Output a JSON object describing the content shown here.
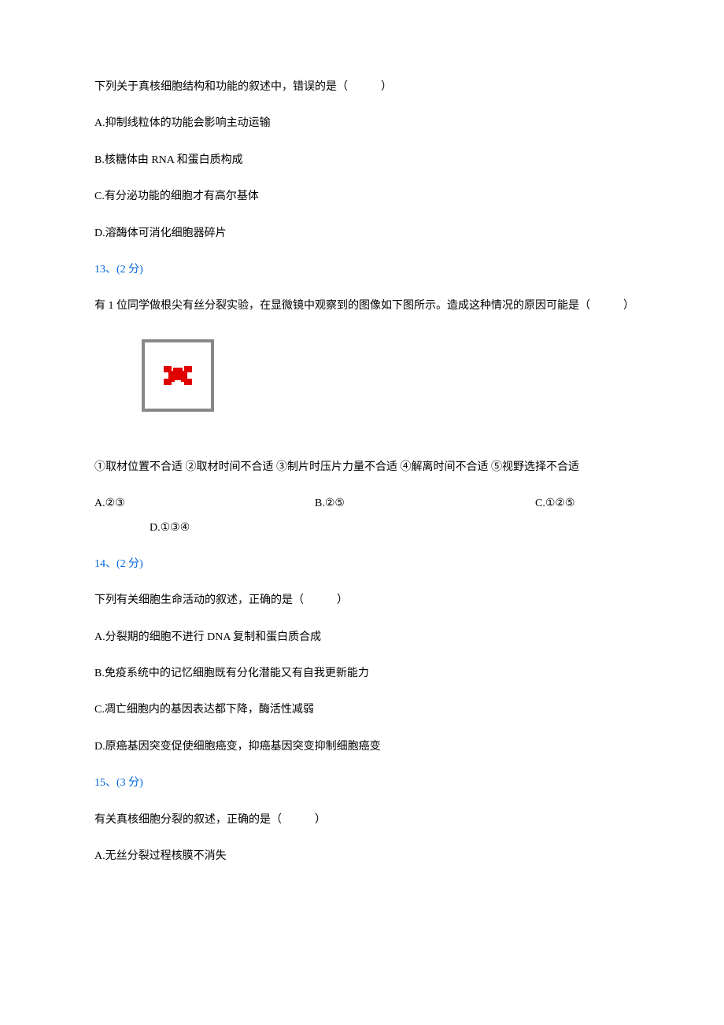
{
  "q12": {
    "stem": "下列关于真核细胞结构和功能的叙述中，错误的是（　　　）",
    "A": "A.抑制线粒体的功能会影响主动运输",
    "B": "B.核糖体由 RNA 和蛋白质构成",
    "C": "C.有分泌功能的细胞才有高尔基体",
    "D": "D.溶酶体可消化细胞器碎片"
  },
  "q13": {
    "num": "13、(2 分)",
    "stem": "有 1 位同学做根尖有丝分裂实验，在显微镜中观察到的图像如下图所示。造成这种情况的原因可能是（　　　）",
    "choices_line": "①取材位置不合适 ②取材时间不合适 ③制片时压片力量不合适 ④解离时间不合适 ⑤视野选择不合适",
    "A": "A.②③",
    "B": "B.②⑤",
    "C": "C.①②⑤",
    "D": "D.①③④"
  },
  "q14": {
    "num": "14、(2 分)",
    "stem": "下列有关细胞生命活动的叙述，正确的是（　　　）",
    "A": "A.分裂期的细胞不进行 DNA 复制和蛋白质合成",
    "B": "B.免疫系统中的记忆细胞既有分化潜能又有自我更新能力",
    "C": "C.凋亡细胞内的基因表达都下降，酶活性减弱",
    "D": "D.原癌基因突变促使细胞癌变，抑癌基因突变抑制细胞癌变"
  },
  "q15": {
    "num": "15、(3 分)",
    "stem": "有关真核细胞分裂的叙述，正确的是（　　　）",
    "A": "A.无丝分裂过程核膜不消失"
  }
}
